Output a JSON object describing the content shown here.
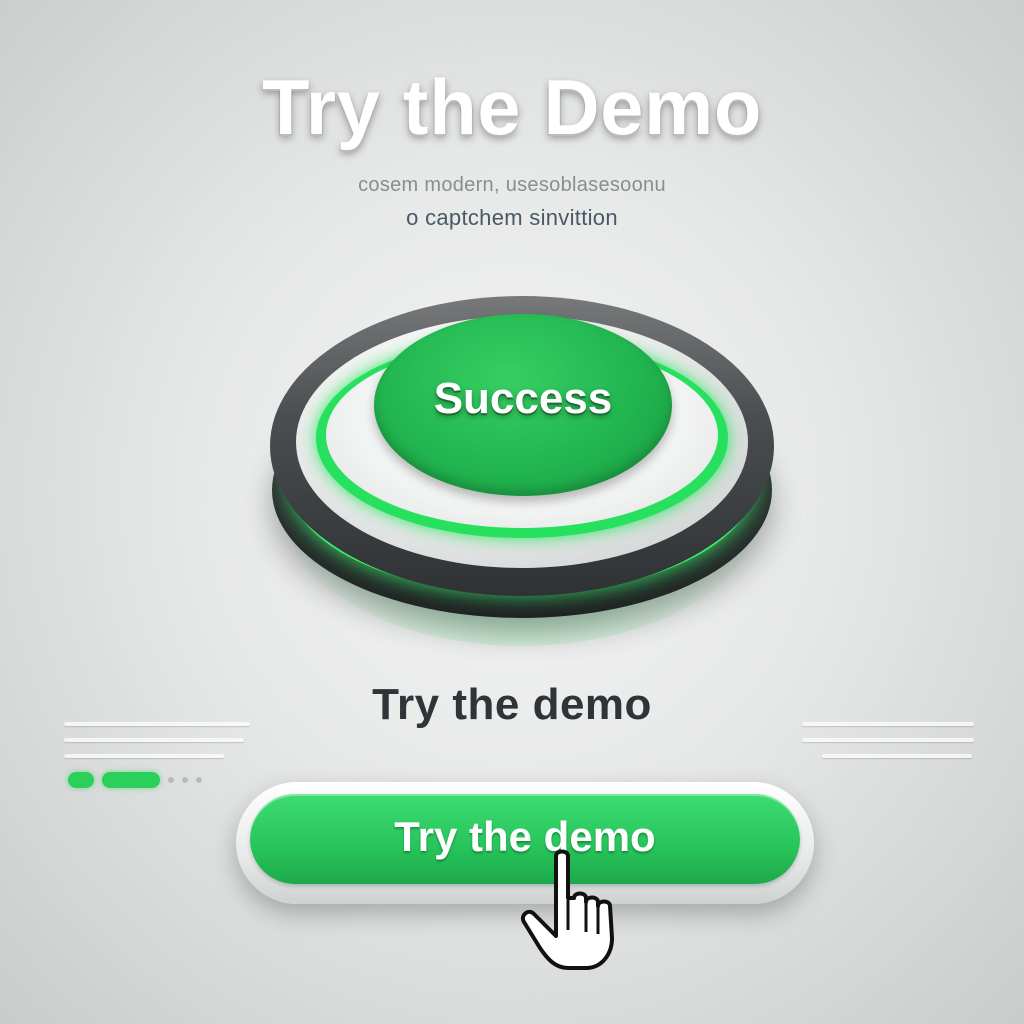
{
  "title": "Try the Demo",
  "subtitle": {
    "line1": "cosem modern, usesoblasesoonu",
    "line2": "o captchem sinvittion"
  },
  "big_button": {
    "label": "Success"
  },
  "demo_heading": "Try the demo",
  "demo_button": {
    "label": "Try the demo"
  },
  "progress": {
    "active_steps": 2,
    "total_steps": 5
  },
  "colors": {
    "accent_green": "#26c45a",
    "neon_green": "#3df06a",
    "background": "#e6e8e7"
  },
  "icons": {
    "cursor": "pointer-hand-icon"
  }
}
